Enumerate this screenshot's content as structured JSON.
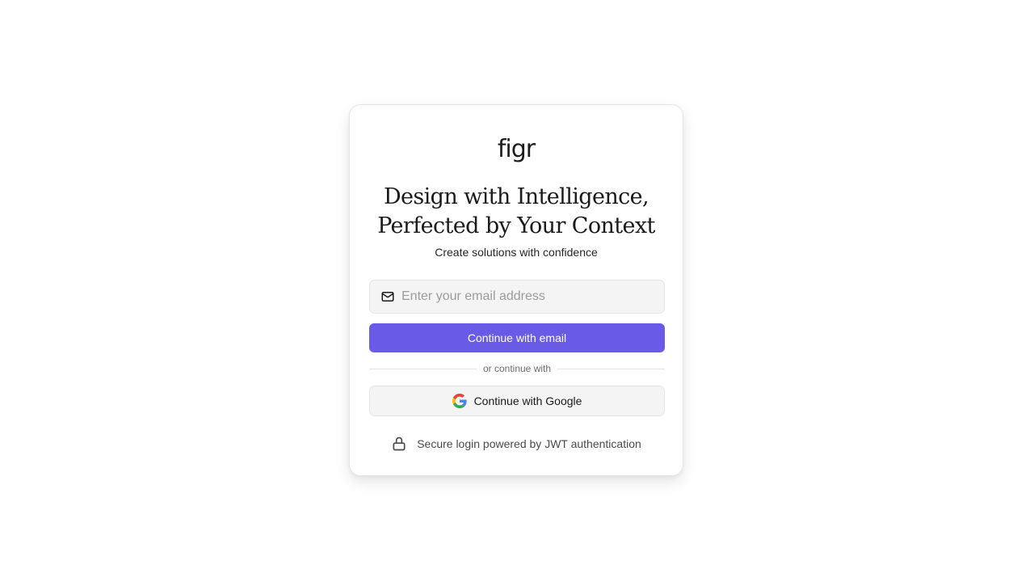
{
  "brand": {
    "logo_text": "figr"
  },
  "hero": {
    "headline_line1": "Design with Intelligence,",
    "headline_line2": "Perfected by Your Context",
    "subtitle": "Create solutions with confidence"
  },
  "email_form": {
    "placeholder": "Enter your email address",
    "value": "",
    "icon": "mail-icon",
    "submit_label": "Continue with email"
  },
  "divider": {
    "text": "or continue with"
  },
  "google": {
    "label": "Continue with Google",
    "icon": "google-icon"
  },
  "footer": {
    "secure_text": "Secure login powered by JWT authentication",
    "icon": "lock-icon"
  },
  "colors": {
    "accent": "#6a5ae8",
    "field_background": "#f4f4f5",
    "border": "#e4e4e7"
  }
}
